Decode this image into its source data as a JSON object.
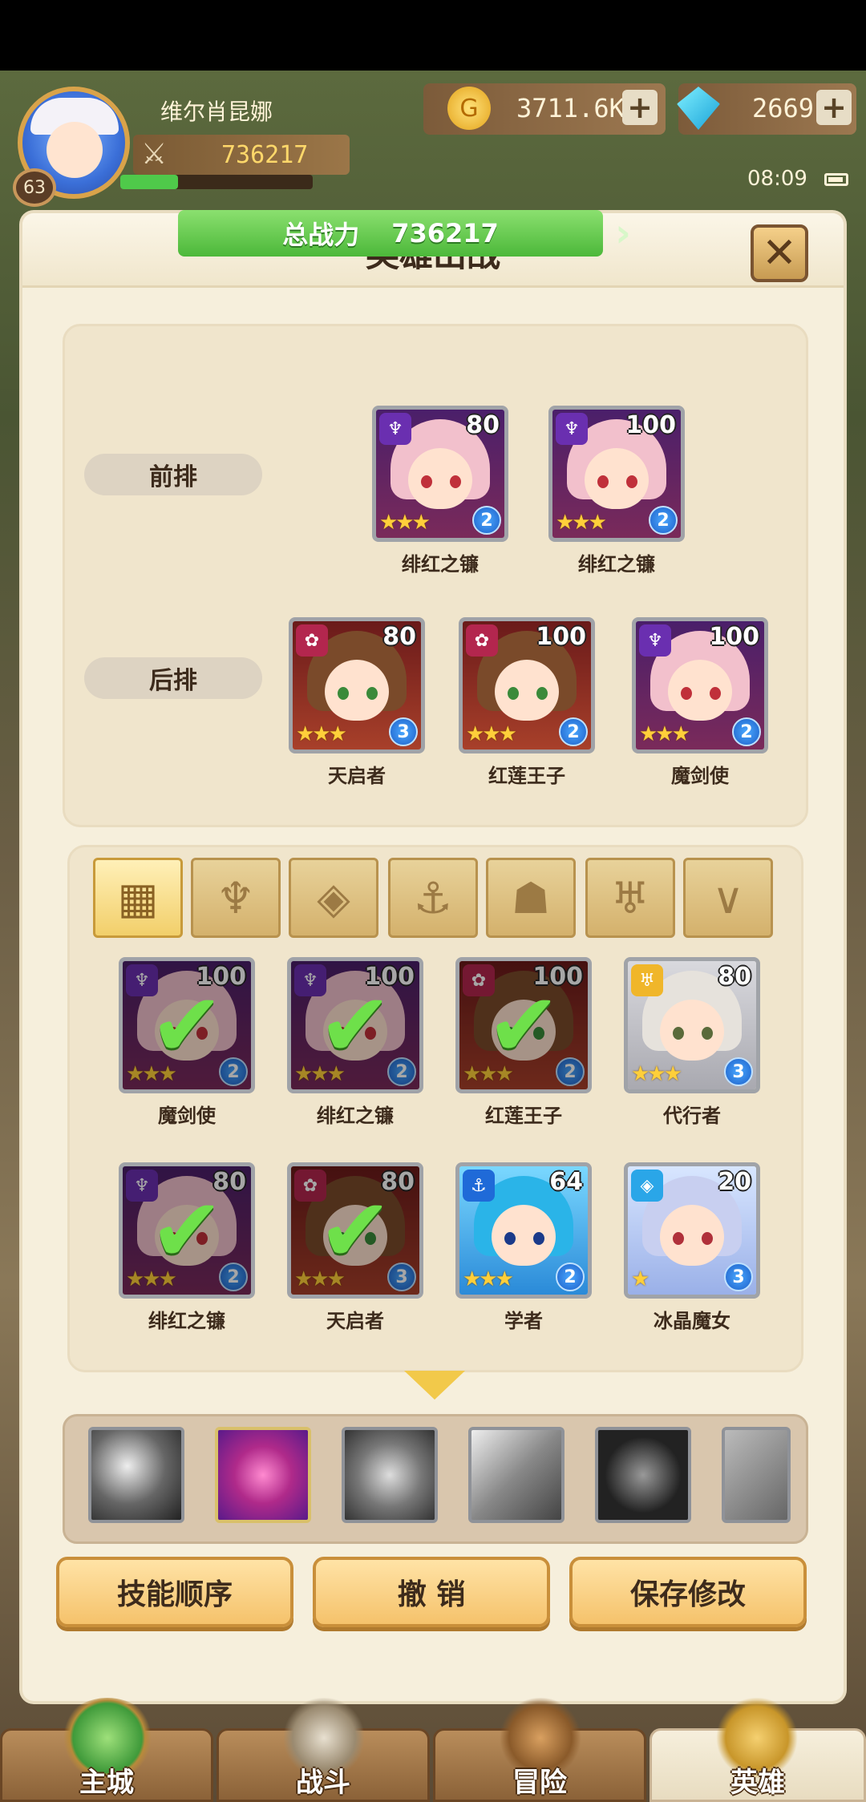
{
  "player": {
    "name": "维尔肖昆娜",
    "level": "63",
    "power": "736217",
    "xp_fraction": 0.3
  },
  "resources": {
    "gold": "3711.6K",
    "gems": "2669",
    "plus": "+"
  },
  "status": {
    "time": "08:09"
  },
  "panel": {
    "title": "英雄出战",
    "close": "✕"
  },
  "lineup": {
    "total_label": "总战力",
    "total_value": "736217",
    "front_label": "前排",
    "back_label": "后排",
    "front": [
      {
        "name": "绯红之镰",
        "level": "80",
        "stars": "★★★",
        "grade": "2",
        "faction": "purple"
      },
      {
        "name": "绯红之镰",
        "level": "100",
        "stars": "★★★",
        "grade": "2",
        "faction": "purple"
      }
    ],
    "back": [
      {
        "name": "天启者",
        "level": "80",
        "stars": "★★★",
        "grade": "3",
        "faction": "crimson"
      },
      {
        "name": "红莲王子",
        "level": "100",
        "stars": "★★★",
        "grade": "2",
        "faction": "crimson"
      },
      {
        "name": "魔剑使",
        "level": "100",
        "stars": "★★★",
        "grade": "2",
        "faction": "purple"
      }
    ]
  },
  "filter_tabs": [
    {
      "icon": "grid-icon",
      "glyph": "▦"
    },
    {
      "icon": "leaf-icon",
      "glyph": "♆"
    },
    {
      "icon": "diamond-icon",
      "glyph": "◈"
    },
    {
      "icon": "anchor-icon",
      "glyph": "⚓"
    },
    {
      "icon": "beast-icon",
      "glyph": "☗"
    },
    {
      "icon": "horns-icon",
      "glyph": "♅"
    },
    {
      "icon": "wings-icon",
      "glyph": "∨"
    }
  ],
  "pool": [
    {
      "name": "魔剑使",
      "level": "100",
      "stars": "★★★",
      "grade": "2",
      "selected": true,
      "faction": "purple"
    },
    {
      "name": "绯红之镰",
      "level": "100",
      "stars": "★★★",
      "grade": "2",
      "selected": true,
      "faction": "purple"
    },
    {
      "name": "红莲王子",
      "level": "100",
      "stars": "★★★",
      "grade": "2",
      "selected": true,
      "faction": "crimson"
    },
    {
      "name": "代行者",
      "level": "80",
      "stars": "★★★",
      "grade": "3",
      "selected": false,
      "faction": "gold"
    },
    {
      "name": "绯红之镰",
      "level": "80",
      "stars": "★★★",
      "grade": "2",
      "selected": true,
      "faction": "purple"
    },
    {
      "name": "天启者",
      "level": "80",
      "stars": "★★★",
      "grade": "3",
      "selected": true,
      "faction": "crimson"
    },
    {
      "name": "学者",
      "level": "64",
      "stars": "★★★",
      "grade": "2",
      "selected": false,
      "faction": "blue"
    },
    {
      "name": "冰晶魔女",
      "level": "20",
      "stars": "★",
      "grade": "3",
      "selected": false,
      "faction": "cyan"
    }
  ],
  "check_glyph": "✔",
  "skills": [
    "skill-1",
    "skill-2",
    "skill-3",
    "skill-4",
    "skill-5",
    "skill-6"
  ],
  "buttons": {
    "order": "技能顺序",
    "undo": "撤 销",
    "save": "保存修改"
  },
  "nav": {
    "city": "主城",
    "battle": "战斗",
    "adventure": "冒险",
    "heroes": "英雄"
  },
  "colors": {
    "purple": "#6a2fb0",
    "crimson": "#b3264e",
    "gold": "#f0b62a",
    "blue": "#1f6ad8",
    "cyan": "#2aa6e8"
  }
}
